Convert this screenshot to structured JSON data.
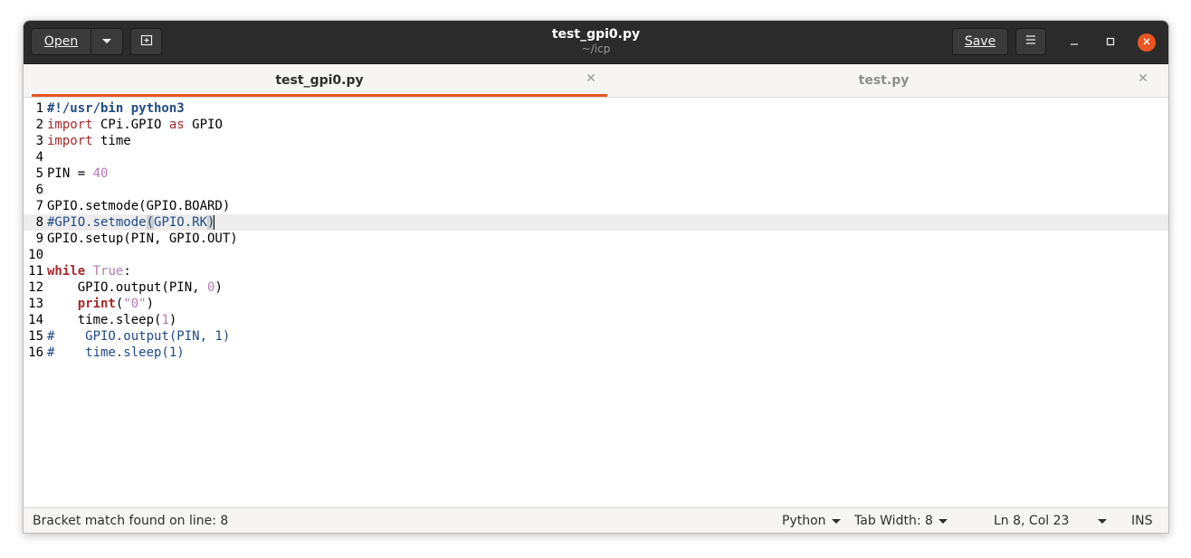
{
  "header": {
    "open_label": "Open",
    "save_label": "Save",
    "title": "test_gpi0.py",
    "subtitle": "~/icp"
  },
  "tabs": [
    {
      "label": "test_gpi0.py",
      "active": true
    },
    {
      "label": "test.py",
      "active": false
    }
  ],
  "editor": {
    "current_line": 8,
    "lines": [
      {
        "n": "1",
        "segs": [
          {
            "t": "#!/usr/bin python3",
            "c": "shebang"
          }
        ]
      },
      {
        "n": "2",
        "segs": [
          {
            "t": "import",
            "c": "kw"
          },
          {
            "t": " CPi.GPIO ",
            "c": ""
          },
          {
            "t": "as",
            "c": "kw"
          },
          {
            "t": " GPIO",
            "c": ""
          }
        ]
      },
      {
        "n": "3",
        "segs": [
          {
            "t": "import",
            "c": "kw"
          },
          {
            "t": " time",
            "c": ""
          }
        ]
      },
      {
        "n": "4",
        "segs": []
      },
      {
        "n": "5",
        "segs": [
          {
            "t": "PIN = ",
            "c": ""
          },
          {
            "t": "40",
            "c": "num"
          }
        ]
      },
      {
        "n": "6",
        "segs": []
      },
      {
        "n": "7",
        "segs": [
          {
            "t": "GPIO.setmode(GPIO.BOARD)",
            "c": ""
          }
        ]
      },
      {
        "n": "8",
        "segs": [
          {
            "t": "#GPIO.setmode",
            "c": "cmt"
          },
          {
            "t": "(",
            "c": "cmt bm"
          },
          {
            "t": "GPIO.RK",
            "c": "cmt"
          },
          {
            "t": ")",
            "c": "cmt bm"
          },
          {
            "t": "",
            "c": "caret"
          }
        ]
      },
      {
        "n": "9",
        "segs": [
          {
            "t": "GPIO.setup(PIN, GPIO.OUT)",
            "c": ""
          }
        ]
      },
      {
        "n": "10",
        "segs": []
      },
      {
        "n": "11",
        "segs": [
          {
            "t": "while",
            "c": "kwb"
          },
          {
            "t": " ",
            "c": ""
          },
          {
            "t": "True",
            "c": "num"
          },
          {
            "t": ":",
            "c": ""
          }
        ]
      },
      {
        "n": "12",
        "segs": [
          {
            "t": "    GPIO.output(PIN, ",
            "c": ""
          },
          {
            "t": "0",
            "c": "num"
          },
          {
            "t": ")",
            "c": ""
          }
        ]
      },
      {
        "n": "13",
        "segs": [
          {
            "t": "    ",
            "c": ""
          },
          {
            "t": "print",
            "c": "kwb"
          },
          {
            "t": "(",
            "c": ""
          },
          {
            "t": "\"0\"",
            "c": "str"
          },
          {
            "t": ")",
            "c": ""
          }
        ]
      },
      {
        "n": "14",
        "segs": [
          {
            "t": "    time.sleep(",
            "c": ""
          },
          {
            "t": "1",
            "c": "num"
          },
          {
            "t": ")",
            "c": ""
          }
        ]
      },
      {
        "n": "15",
        "segs": [
          {
            "t": "#    GPIO.output(PIN, 1)",
            "c": "cmt"
          }
        ]
      },
      {
        "n": "16",
        "segs": [
          {
            "t": "#    time.sleep(1)",
            "c": "cmt"
          }
        ]
      }
    ]
  },
  "status": {
    "message": "Bracket match found on line: 8",
    "language": "Python",
    "tab_width": "Tab Width: 8",
    "position": "Ln 8, Col 23",
    "mode": "INS"
  }
}
